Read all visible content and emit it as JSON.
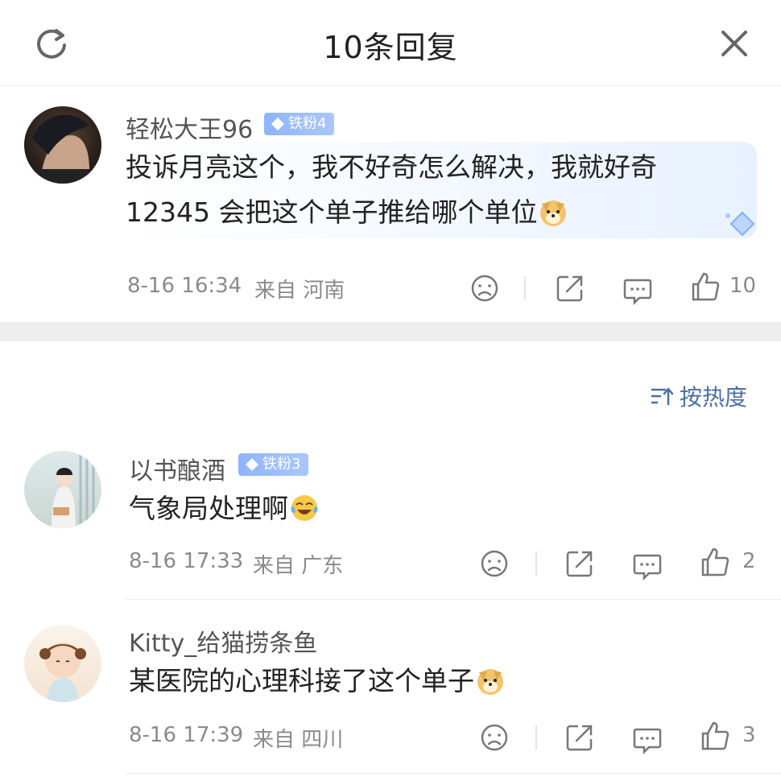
{
  "header": {
    "title": "10条回复"
  },
  "main_comment": {
    "username": "轻松大王96",
    "badge": "铁粉4",
    "text_line1": "投诉月亮这个，我不好奇怎么解决，我就好奇",
    "text_line2": "12345 会把这个单子推给哪个单位",
    "timestamp": "8-16 16:34",
    "location": "来自 河南",
    "likes": "10"
  },
  "sort": {
    "label": "按热度"
  },
  "replies": [
    {
      "username": "以书酿酒",
      "badge": "铁粉3",
      "text": "气象局处理啊",
      "timestamp": "8-16 17:33",
      "location": "来自 广东",
      "likes": "2"
    },
    {
      "username": "Kitty_给猫捞条鱼",
      "badge": "",
      "text": "某医院的心理科接了这个单子",
      "timestamp": "8-16 17:39",
      "location": "来自 四川",
      "likes": "3"
    }
  ],
  "colors": {
    "accent": "#4a6fa5",
    "badge": "#9bbcff",
    "meta": "#8a8a8a"
  },
  "icons": [
    "refresh-icon",
    "close-icon",
    "dislike-icon",
    "share-icon",
    "comment-icon",
    "like-icon",
    "doge-emoji",
    "laugh-cry-emoji",
    "sort-icon",
    "gem-icon"
  ]
}
